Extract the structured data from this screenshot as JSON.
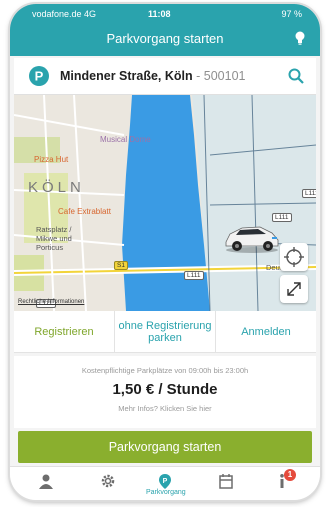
{
  "status_bar": {
    "carrier": "vodafone.de  4G",
    "time": "11:08",
    "battery": "97 %"
  },
  "header": {
    "title": "Parkvorgang starten",
    "icon": "lightbulb-icon"
  },
  "search": {
    "street": "Mindener Straße, Köln",
    "separator": " - ",
    "zip": "500101",
    "icon": "search-icon"
  },
  "map": {
    "city_label": "KÖLN",
    "pois": {
      "musical_dome": "Musical Dome",
      "pizza_hut": "Pizza Hut",
      "cafe": "Cafe Extrablatt",
      "area": "Ratsplatz / Mikwe und Porticus"
    },
    "roads": {
      "s1": "S1",
      "l111_a": "L111",
      "l111_b": "L111",
      "l111_c": "L111",
      "l111_d": "L111"
    },
    "deutz_label": "Deutz",
    "attribution": "Rechtliche Informationen"
  },
  "options": {
    "register": "Registrieren",
    "no_register": "ohne Registrierung parken",
    "login": "Anmelden"
  },
  "info": {
    "note": "Kostenpflichtige Parkplätze von 09:00h bis 23:00h",
    "price": "1,50 € / Stunde",
    "more": "Mehr Infos? Klicken Sie hier"
  },
  "cta": {
    "label": "Parkvorgang starten"
  },
  "tabbar": {
    "active_label": "Parkvorgang",
    "badge": "1"
  },
  "colors": {
    "teal": "#2aa3ad",
    "green": "#8aaf2e",
    "river": "#3a9be4"
  }
}
